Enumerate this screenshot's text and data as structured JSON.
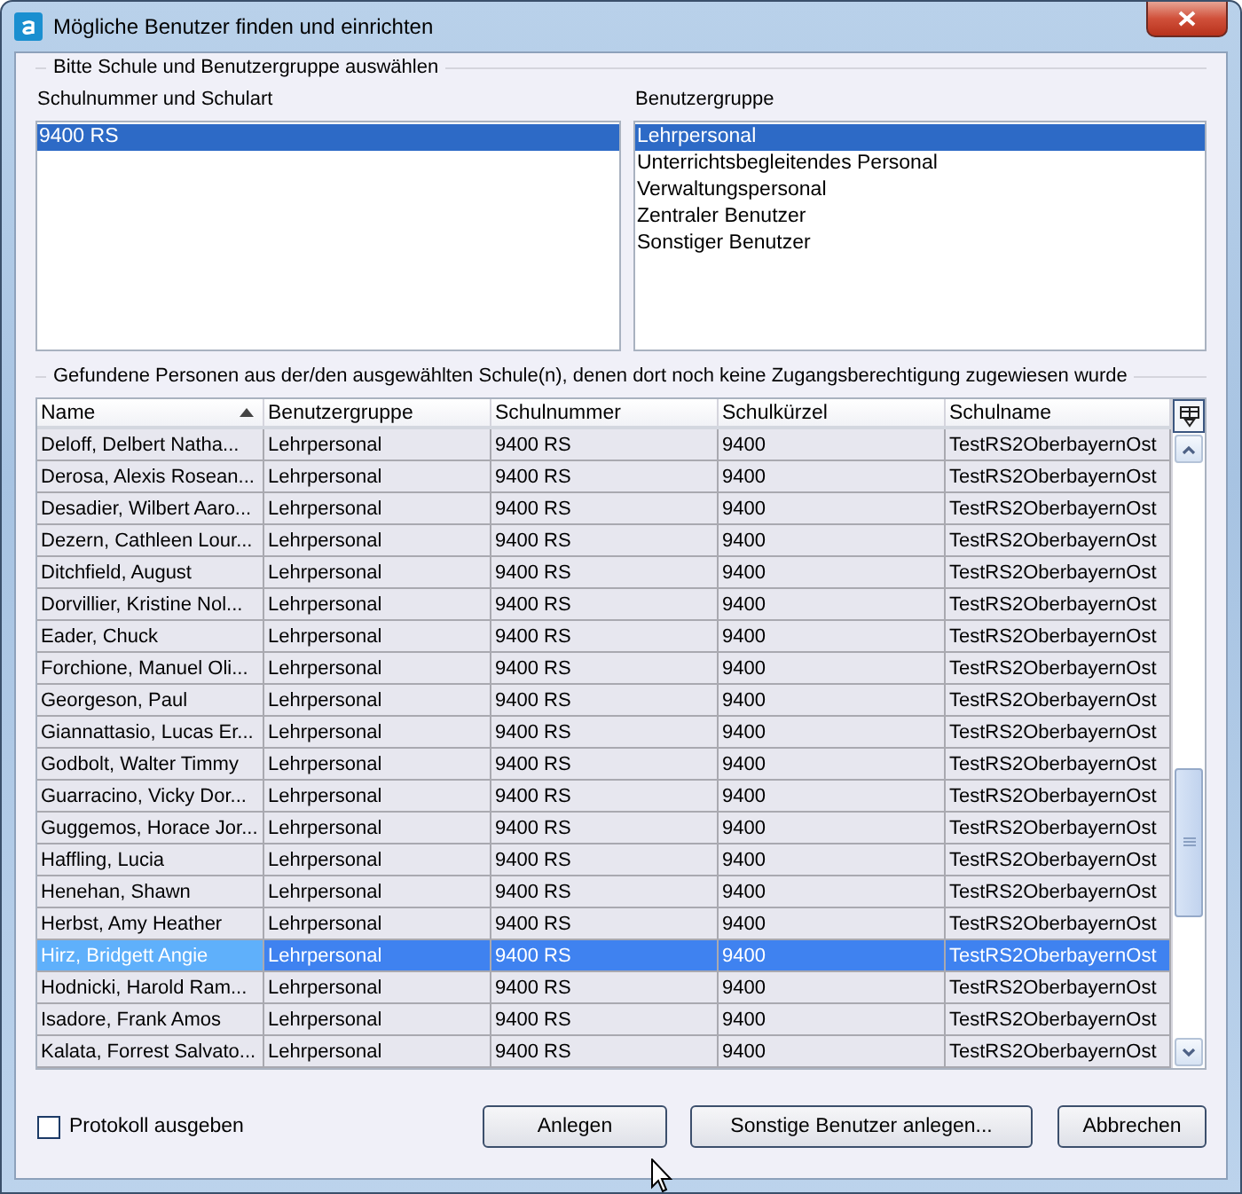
{
  "window": {
    "title": "Mögliche Benutzer finden und einrichten"
  },
  "selection_group": {
    "legend": "Bitte Schule und Benutzergruppe auswählen",
    "schools": {
      "label": "Schulnummer und Schulart",
      "items": [
        {
          "text": "9400 RS",
          "selected": true
        }
      ]
    },
    "user_groups": {
      "label": "Benutzergruppe",
      "items": [
        {
          "text": "Lehrpersonal",
          "selected": true
        },
        {
          "text": "Unterrichtsbegleitendes Personal",
          "selected": false
        },
        {
          "text": "Verwaltungspersonal",
          "selected": false
        },
        {
          "text": "Zentraler Benutzer",
          "selected": false
        },
        {
          "text": "Sonstiger Benutzer",
          "selected": false
        }
      ]
    }
  },
  "results_group": {
    "legend": "Gefundene Personen aus der/den ausgewählten Schule(n), denen dort noch keine Zugangsberechtigung zugewiesen wurde",
    "table": {
      "columns": [
        {
          "label": "Name",
          "sorted": true
        },
        {
          "label": "Benutzergruppe",
          "sorted": false
        },
        {
          "label": "Schulnummer",
          "sorted": false
        },
        {
          "label": "Schulkürzel",
          "sorted": false
        },
        {
          "label": "Schulname",
          "sorted": false
        }
      ],
      "rows": [
        {
          "cells": [
            "Deloff, Delbert Natha...",
            "Lehrpersonal",
            "9400 RS",
            "9400",
            "TestRS2OberbayernOst"
          ],
          "selected": false
        },
        {
          "cells": [
            "Derosa, Alexis Rosean...",
            "Lehrpersonal",
            "9400 RS",
            "9400",
            "TestRS2OberbayernOst"
          ],
          "selected": false
        },
        {
          "cells": [
            "Desadier, Wilbert Aaro...",
            "Lehrpersonal",
            "9400 RS",
            "9400",
            "TestRS2OberbayernOst"
          ],
          "selected": false
        },
        {
          "cells": [
            "Dezern, Cathleen Lour...",
            "Lehrpersonal",
            "9400 RS",
            "9400",
            "TestRS2OberbayernOst"
          ],
          "selected": false
        },
        {
          "cells": [
            "Ditchfield, August",
            "Lehrpersonal",
            "9400 RS",
            "9400",
            "TestRS2OberbayernOst"
          ],
          "selected": false
        },
        {
          "cells": [
            "Dorvillier, Kristine Nol...",
            "Lehrpersonal",
            "9400 RS",
            "9400",
            "TestRS2OberbayernOst"
          ],
          "selected": false
        },
        {
          "cells": [
            "Eader, Chuck",
            "Lehrpersonal",
            "9400 RS",
            "9400",
            "TestRS2OberbayernOst"
          ],
          "selected": false
        },
        {
          "cells": [
            "Forchione, Manuel Oli...",
            "Lehrpersonal",
            "9400 RS",
            "9400",
            "TestRS2OberbayernOst"
          ],
          "selected": false
        },
        {
          "cells": [
            "Georgeson, Paul",
            "Lehrpersonal",
            "9400 RS",
            "9400",
            "TestRS2OberbayernOst"
          ],
          "selected": false
        },
        {
          "cells": [
            "Giannattasio, Lucas Er...",
            "Lehrpersonal",
            "9400 RS",
            "9400",
            "TestRS2OberbayernOst"
          ],
          "selected": false
        },
        {
          "cells": [
            "Godbolt, Walter Timmy",
            "Lehrpersonal",
            "9400 RS",
            "9400",
            "TestRS2OberbayernOst"
          ],
          "selected": false
        },
        {
          "cells": [
            "Guarracino, Vicky Dor...",
            "Lehrpersonal",
            "9400 RS",
            "9400",
            "TestRS2OberbayernOst"
          ],
          "selected": false
        },
        {
          "cells": [
            "Guggemos, Horace Jor...",
            "Lehrpersonal",
            "9400 RS",
            "9400",
            "TestRS2OberbayernOst"
          ],
          "selected": false
        },
        {
          "cells": [
            "Haffling, Lucia",
            "Lehrpersonal",
            "9400 RS",
            "9400",
            "TestRS2OberbayernOst"
          ],
          "selected": false
        },
        {
          "cells": [
            "Henehan, Shawn",
            "Lehrpersonal",
            "9400 RS",
            "9400",
            "TestRS2OberbayernOst"
          ],
          "selected": false
        },
        {
          "cells": [
            "Herbst, Amy Heather",
            "Lehrpersonal",
            "9400 RS",
            "9400",
            "TestRS2OberbayernOst"
          ],
          "selected": false
        },
        {
          "cells": [
            "Hirz, Bridgett Angie",
            "Lehrpersonal",
            "9400 RS",
            "9400",
            "TestRS2OberbayernOst"
          ],
          "selected": true
        },
        {
          "cells": [
            "Hodnicki, Harold Ram...",
            "Lehrpersonal",
            "9400 RS",
            "9400",
            "TestRS2OberbayernOst"
          ],
          "selected": false
        },
        {
          "cells": [
            "Isadore, Frank Amos",
            "Lehrpersonal",
            "9400 RS",
            "9400",
            "TestRS2OberbayernOst"
          ],
          "selected": false
        },
        {
          "cells": [
            "Kalata, Forrest Salvato...",
            "Lehrpersonal",
            "9400 RS",
            "9400",
            "TestRS2OberbayernOst"
          ],
          "selected": false
        }
      ]
    }
  },
  "footer": {
    "checkbox": {
      "label": "Protokoll ausgeben",
      "checked": false
    },
    "buttons": [
      "Anlegen",
      "Sonstige Benutzer anlegen...",
      "Abbrechen"
    ]
  }
}
